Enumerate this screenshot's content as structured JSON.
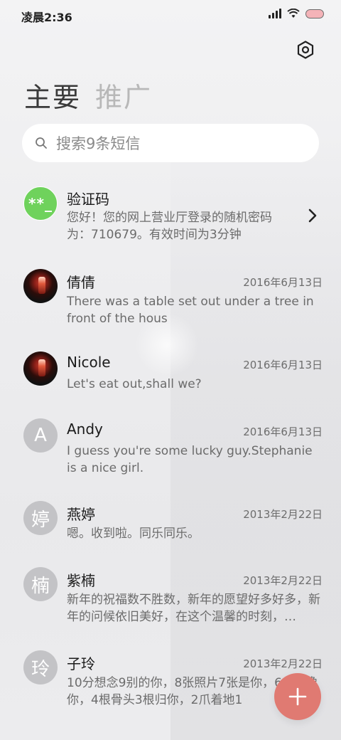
{
  "status_bar": {
    "time": "凌晨2:36",
    "icons": [
      "signal-icon",
      "wifi-icon",
      "battery-icon"
    ],
    "battery_color": "#f4b3b8"
  },
  "header": {
    "settings_icon": "settings-icon"
  },
  "tabs": [
    {
      "label": "主要",
      "active": true
    },
    {
      "label": "推广",
      "active": false
    }
  ],
  "search": {
    "placeholder": "搜索9条短信",
    "icon": "search-icon"
  },
  "messages": [
    {
      "avatar_type": "code",
      "avatar_text": "**_",
      "avatar_color": "#6fd25c",
      "name": "验证码",
      "date": "",
      "preview": "您好！您的网上营业厅登录的随机密码为：710679。有效时间为3分钟",
      "has_chevron": true
    },
    {
      "avatar_type": "photo",
      "avatar_text": "",
      "name": "倩倩",
      "date": "2016年6月13日",
      "preview": "There was a table set out under a tree in front of the hous"
    },
    {
      "avatar_type": "photo",
      "avatar_text": "",
      "name": "Nicole",
      "date": "2016年6月13日",
      "preview": "Let's eat out,shall we?"
    },
    {
      "avatar_type": "letter",
      "avatar_text": "A",
      "name": "Andy",
      "date": "2016年6月13日",
      "preview": "I guess you're some lucky guy.Stephanie is a nice girl."
    },
    {
      "avatar_type": "letter",
      "avatar_text": "婷",
      "name": "燕婷",
      "date": "2013年2月22日",
      "preview": "嗯。收到啦。同乐同乐。"
    },
    {
      "avatar_type": "letter",
      "avatar_text": "楠",
      "name": "紫楠",
      "date": "2013年2月22日",
      "preview": "新年的祝福数不胜数，新年的愿望好多好多，新年的问候依旧美好，在这个温馨的时刻，…"
    },
    {
      "avatar_type": "letter",
      "avatar_text": "玲",
      "name": "子玲",
      "date": "2013年2月22日",
      "preview": "10分想念9别的你，8张照片7张是你，6 5只像你，4根骨头3根归你，2爪着地1"
    }
  ],
  "fab": {
    "icon": "plus-icon",
    "color": "#e07a72"
  },
  "colors": {
    "avatar_gray": "#c3c3c6",
    "text_primary": "#1b1b1b",
    "text_secondary": "#6b6b6b"
  }
}
